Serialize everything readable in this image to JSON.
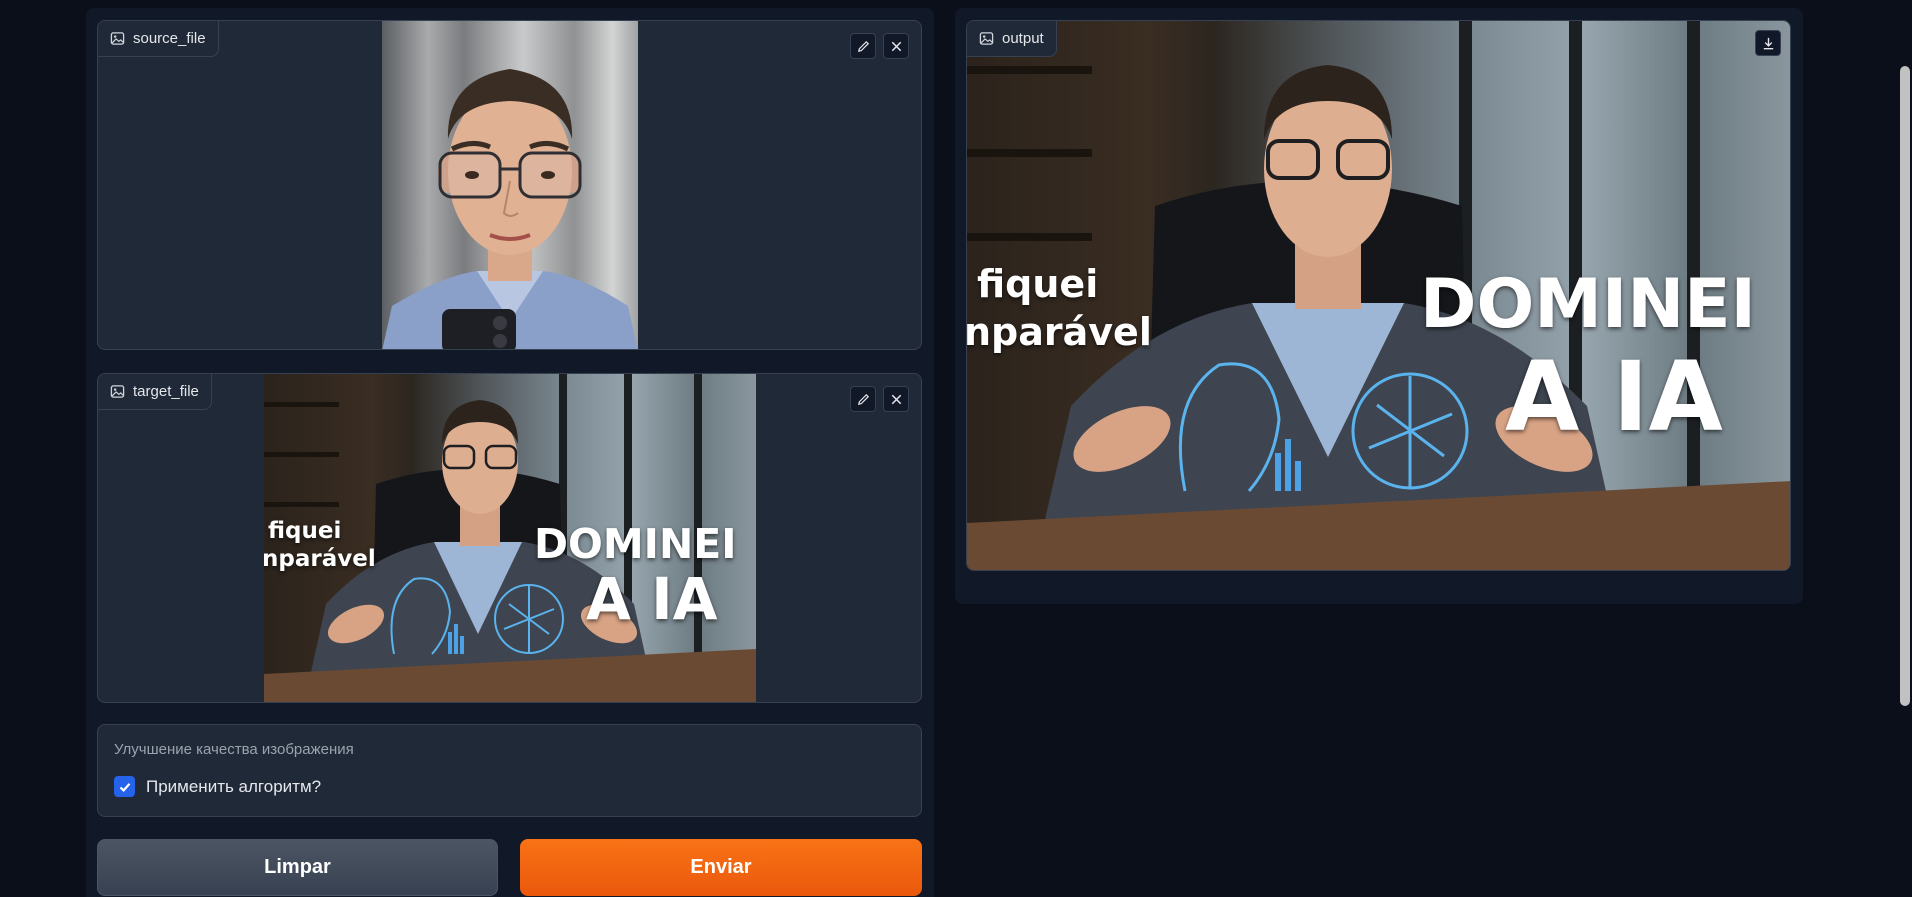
{
  "source": {
    "label": "source_file",
    "icon": "image-icon",
    "edit_icon": "pencil-icon",
    "clear_icon": "close-icon"
  },
  "target": {
    "label": "target_file",
    "icon": "image-icon",
    "edit_icon": "pencil-icon",
    "clear_icon": "close-icon",
    "thumbnail_text": {
      "line1": "fiquei",
      "line2": "nparável",
      "headline1": "DOMINEI",
      "headline2": "A IA"
    }
  },
  "output": {
    "label": "output",
    "icon": "image-icon",
    "download_icon": "download-icon",
    "thumbnail_text": {
      "line1": "fiquei",
      "line2": "nparável",
      "headline1": "DOMINEI",
      "headline2": "A IA"
    }
  },
  "settings": {
    "title": "Улучшение качества изображения",
    "checkbox_label": "Применить алгоритм?",
    "checkbox_checked": true
  },
  "buttons": {
    "clear_label": "Limpar",
    "submit_label": "Enviar"
  },
  "colors": {
    "accent": "#f97316",
    "checkbox": "#2563eb",
    "panel": "#1f2937",
    "background": "#0b0f19"
  }
}
